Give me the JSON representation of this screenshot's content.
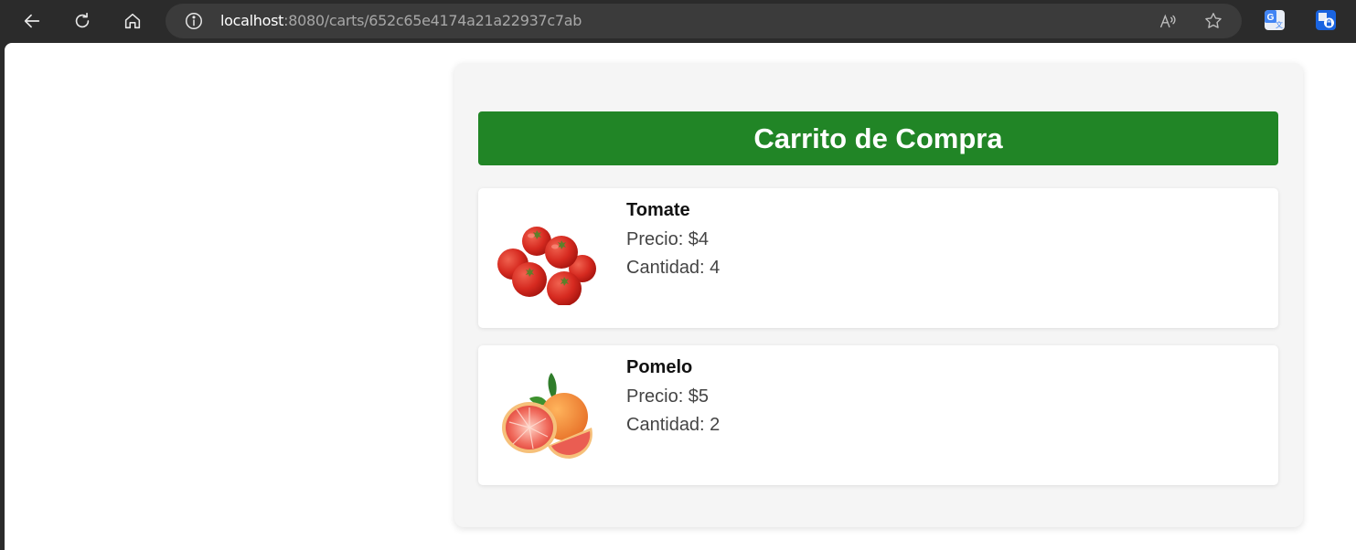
{
  "browser": {
    "url_host": "localhost",
    "url_rest": ":8080/carts/652c65e4174a21a22937c7ab",
    "icons": [
      "back-icon",
      "refresh-icon",
      "home-icon",
      "info-icon",
      "read-aloud-icon",
      "favorite-star-icon",
      "translate-extension-icon",
      "shield-extension-icon"
    ]
  },
  "cart": {
    "title": "Carrito de Compra",
    "accent_color": "#218526",
    "items": [
      {
        "name": "Tomate",
        "price_label": "Precio: $4",
        "qty_label": "Cantidad: 4",
        "image": "tomatoes-image"
      },
      {
        "name": "Pomelo",
        "price_label": "Precio: $5",
        "qty_label": "Cantidad: 2",
        "image": "grapefruit-image"
      }
    ]
  }
}
